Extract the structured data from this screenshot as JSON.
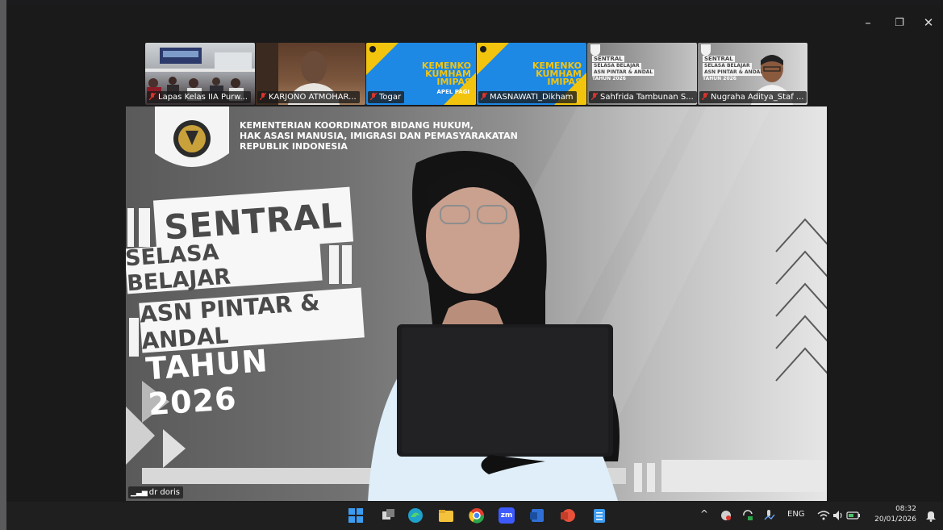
{
  "window": {
    "controls": {
      "minimize": "–",
      "restore": "❐",
      "close": "✕"
    }
  },
  "participants": [
    {
      "name": "Lapas Kelas IIA Purw..."
    },
    {
      "name": "KARJONO ATMOHAR..."
    },
    {
      "name": "Togar"
    },
    {
      "name": "MASNAWATI_Dikham"
    },
    {
      "name": "Sahfrida Tambunan S..."
    },
    {
      "name": "Nugraha Aditya_Staf ..."
    }
  ],
  "thumbs": {
    "kemenko_lines": [
      "KEMENKO",
      "KUMHAM",
      "IMIPAS"
    ],
    "apel": "APEL PAGI",
    "mini_banner": [
      "SENTRAL",
      "SELASA BELAJAR",
      "ASN PINTAR & ANDAL",
      "TAHUN 2026"
    ]
  },
  "main_speaker": {
    "name": "dr doris",
    "ministry_lines": [
      "KEMENTERIAN KOORDINATOR BIDANG HUKUM,",
      "HAK ASASI MANUSIA, IMIGRASI DAN PEMASYARAKATAN",
      "REPUBLIK INDONESIA"
    ],
    "banner": {
      "line1": "SENTRAL",
      "line2": "SELASA BELAJAR",
      "line3": "ASN PINTAR & ANDAL",
      "line4": "TAHUN 2026"
    }
  },
  "taskbar": {
    "apps": [
      "windows-start",
      "task-view",
      "edge",
      "file-explorer",
      "chrome",
      "zoom",
      "word",
      "powerpoint",
      "notepad"
    ],
    "zoom_label": "zm",
    "tray": {
      "chevron": "^",
      "language": "ENG",
      "time": "08:32",
      "date": "20/01/2026"
    }
  },
  "colors": {
    "accent_blue": "#1e88e5",
    "kemenko_yellow": "#f2c40d",
    "muted_red": "#d9342b",
    "windows_blue": "#3b9cf0"
  }
}
